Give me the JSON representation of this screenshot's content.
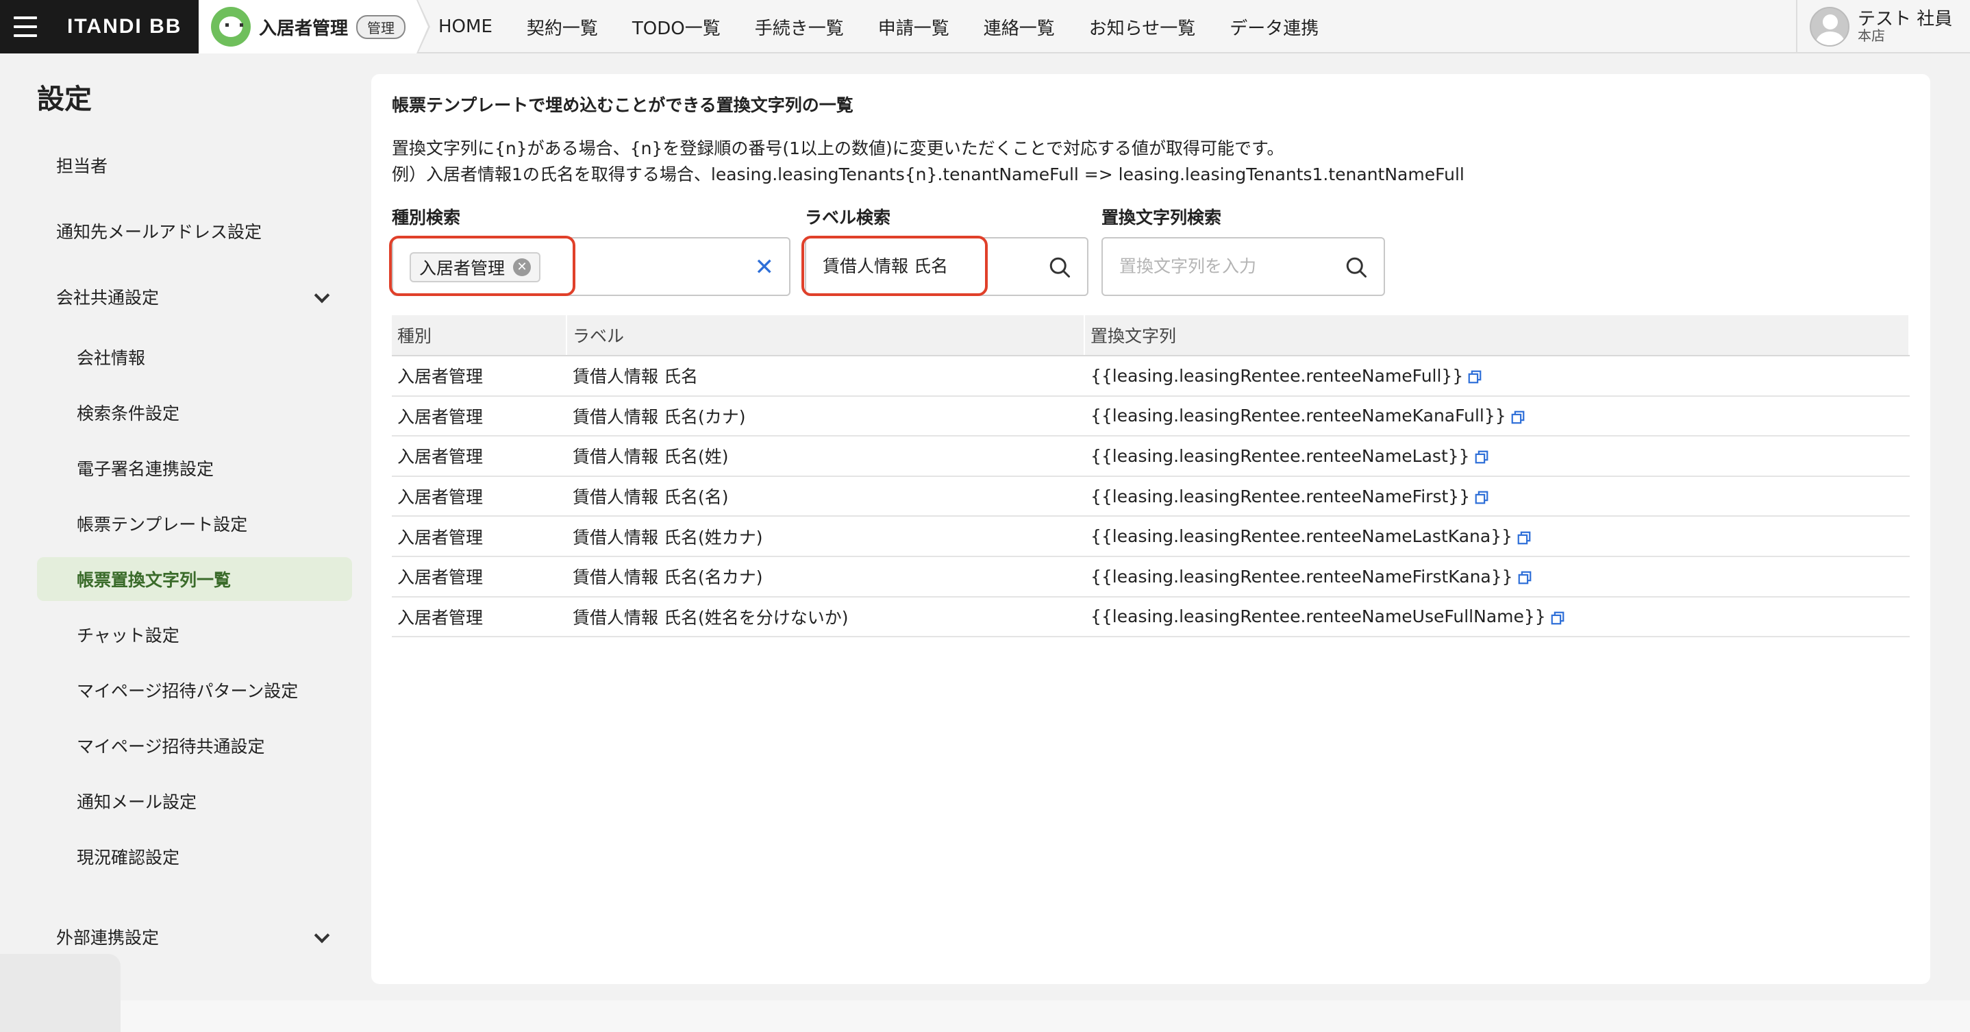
{
  "header": {
    "brand": "ITANDI BB",
    "app_name": "入居者管理",
    "app_badge": "管理",
    "nav": [
      "HOME",
      "契約一覧",
      "TODO一覧",
      "手続き一覧",
      "申請一覧",
      "連絡一覧",
      "お知らせ一覧",
      "データ連携"
    ],
    "user_name": "テスト 社員",
    "user_store": "本店"
  },
  "sidebar": {
    "title": "設定",
    "items": [
      {
        "label": "担当者"
      },
      {
        "label": "通知先メールアドレス設定"
      },
      {
        "label": "会社共通設定"
      },
      {
        "label": "会社情報"
      },
      {
        "label": "検索条件設定"
      },
      {
        "label": "電子署名連携設定"
      },
      {
        "label": "帳票テンプレート設定"
      },
      {
        "label": "帳票置換文字列一覧"
      },
      {
        "label": "チャット設定"
      },
      {
        "label": "マイページ招待パターン設定"
      },
      {
        "label": "マイページ招待共通設定"
      },
      {
        "label": "通知メール設定"
      },
      {
        "label": "現況確認設定"
      },
      {
        "label": "外部連携設定"
      }
    ]
  },
  "main": {
    "title": "帳票テンプレートで埋め込むことができる置換文字列の一覧",
    "desc_line1": "置換文字列に{n}がある場合、{n}を登録順の番号(1以上の数値)に変更いただくことで対応する値が取得可能です。",
    "desc_line2": "例）入居者情報1の氏名を取得する場合、leasing.leasingTenants{n}.tenantNameFull => leasing.leasingTenants1.tenantNameFull",
    "filters": {
      "type_label": "種別検索",
      "type_chip": "入居者管理",
      "label_label": "ラベル検索",
      "label_value": "賃借人情報 氏名",
      "string_label": "置換文字列検索",
      "string_placeholder": "置換文字列を入力"
    },
    "table": {
      "headers": [
        "種別",
        "ラベル",
        "置換文字列"
      ],
      "rows": [
        {
          "type": "入居者管理",
          "label": "賃借人情報 氏名",
          "string": "{{leasing.leasingRentee.renteeNameFull}}"
        },
        {
          "type": "入居者管理",
          "label": "賃借人情報 氏名(カナ)",
          "string": "{{leasing.leasingRentee.renteeNameKanaFull}}"
        },
        {
          "type": "入居者管理",
          "label": "賃借人情報 氏名(姓)",
          "string": "{{leasing.leasingRentee.renteeNameLast}}"
        },
        {
          "type": "入居者管理",
          "label": "賃借人情報 氏名(名)",
          "string": "{{leasing.leasingRentee.renteeNameFirst}}"
        },
        {
          "type": "入居者管理",
          "label": "賃借人情報 氏名(姓カナ)",
          "string": "{{leasing.leasingRentee.renteeNameLastKana}}"
        },
        {
          "type": "入居者管理",
          "label": "賃借人情報 氏名(名カナ)",
          "string": "{{leasing.leasingRentee.renteeNameFirstKana}}"
        },
        {
          "type": "入居者管理",
          "label": "賃借人情報 氏名(姓名を分けないか)",
          "string": "{{leasing.leasingRentee.renteeNameUseFullName}}"
        }
      ]
    }
  },
  "colors": {
    "highlight": "#e0402a",
    "active_bg": "#e4eedc",
    "link_blue": "#2e6fd8"
  }
}
